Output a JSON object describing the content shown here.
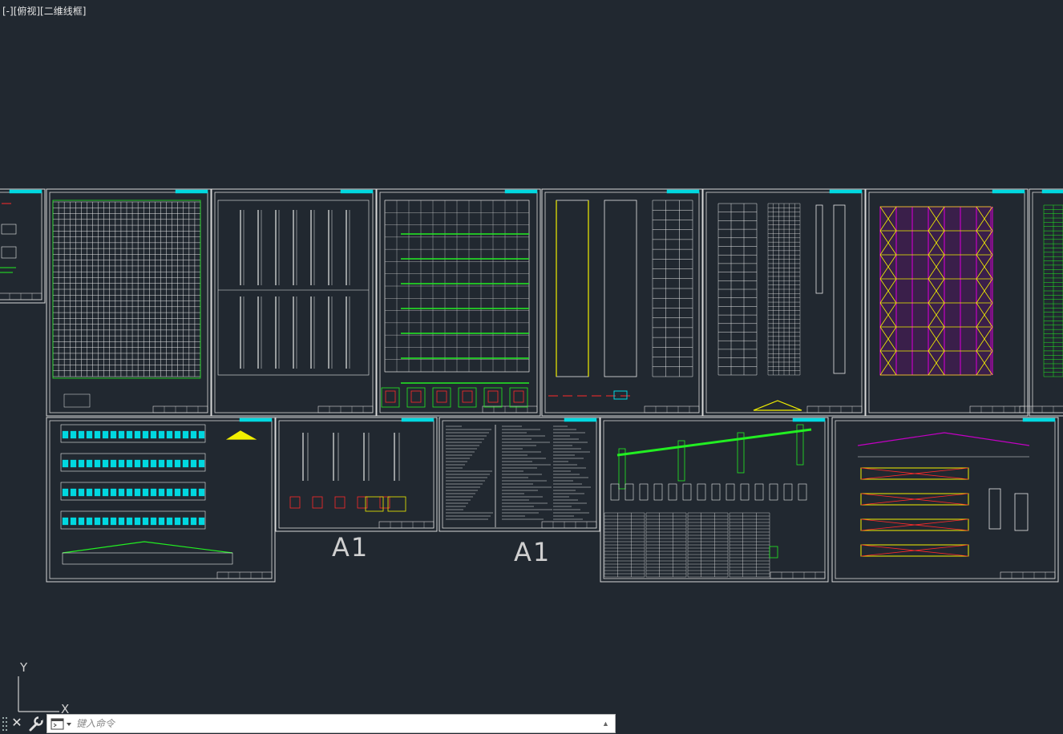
{
  "viewport": {
    "label": "[-][俯视][二维线框]",
    "background": "#212830"
  },
  "sheets": {
    "size_labels": [
      "A1",
      "A1"
    ]
  },
  "ucs": {
    "x_label": "X",
    "y_label": "Y"
  },
  "command_line": {
    "placeholder": "键入命令"
  },
  "colors": {
    "sheet_border": "#d8d8d8",
    "title_block_cyan": "#00d8e0",
    "grid_white": "#e8e8e8",
    "member_green": "#22ee22",
    "member_yellow": "#f2f000",
    "member_magenta": "#c400c4",
    "member_red": "#ff2a2a",
    "ucs_gray": "#d0d0d0"
  },
  "icons": [
    "close-icon",
    "wrench-icon",
    "command-prompt-icon",
    "recent-commands-icon",
    "grip-icon"
  ]
}
